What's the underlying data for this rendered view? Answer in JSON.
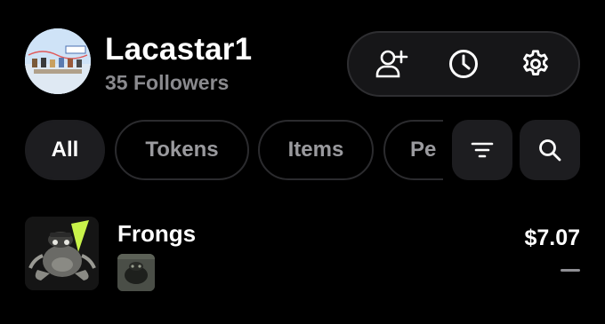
{
  "profile": {
    "username": "Lacastar1",
    "followers": "35 Followers",
    "avatar_icon": "profile-banner-image"
  },
  "actions": {
    "add_friend_icon": "add-user-icon",
    "activity_icon": "clock-icon",
    "settings_icon": "gear-icon"
  },
  "filters": {
    "chips": [
      {
        "label": "All",
        "active": true
      },
      {
        "label": "Tokens",
        "active": false
      },
      {
        "label": "Items",
        "active": false
      },
      {
        "label": "Pe",
        "active": false
      }
    ],
    "filter_icon": "filter-icon",
    "search_icon": "search-icon"
  },
  "items": [
    {
      "name": "Frongs",
      "price": "$7.07",
      "change": "—",
      "thumbnail_icon": "frog-image",
      "sub_thumbnail_icon": "frog-nft-image"
    }
  ],
  "colors": {
    "background": "#000000",
    "chip_active": "#1d1d20",
    "muted_text": "#8a8a8e",
    "accent_green": "#c8f24a"
  }
}
